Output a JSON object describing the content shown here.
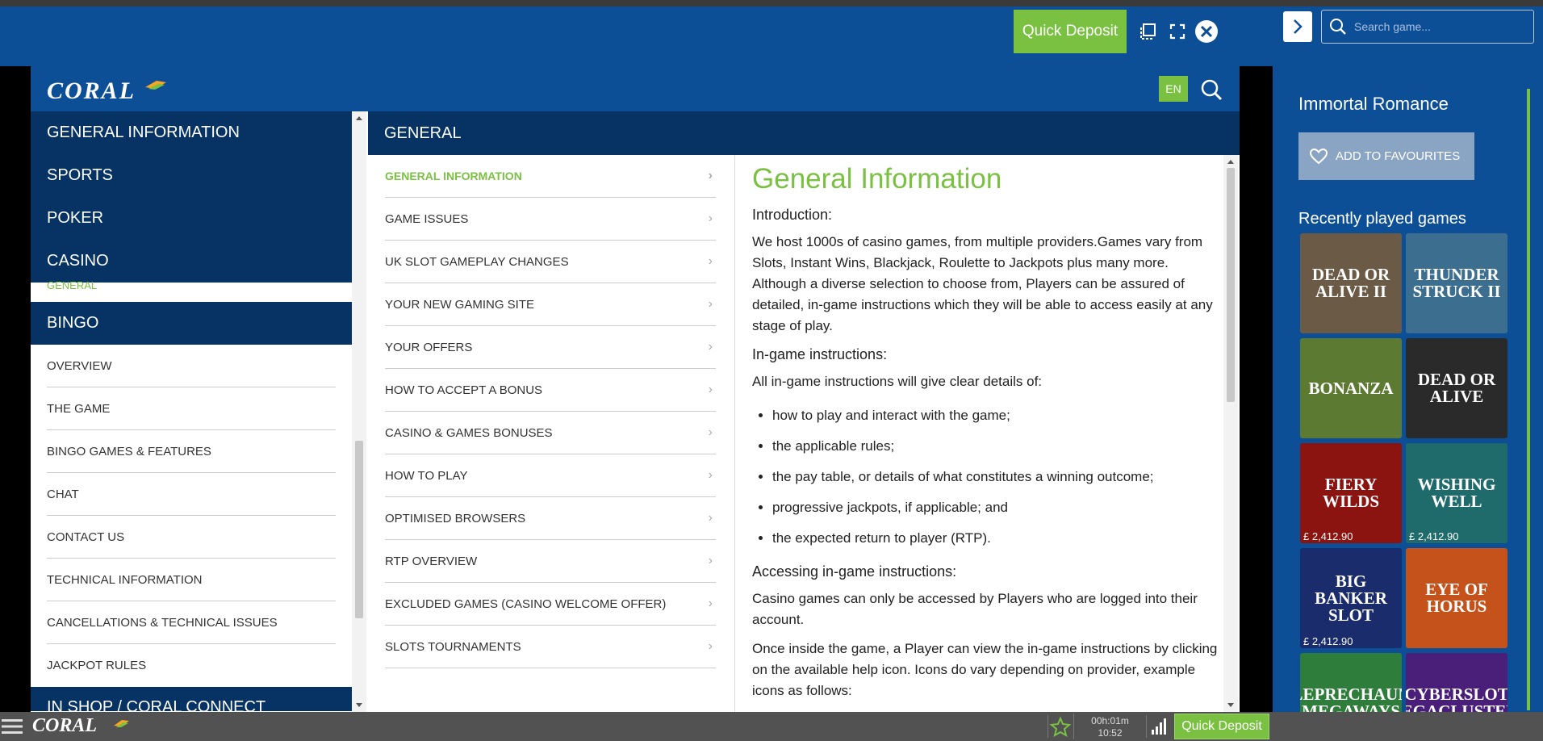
{
  "top_bar": {
    "quick_deposit": "Quick Deposit",
    "search_placeholder": "Search game..."
  },
  "help": {
    "logo": "CORAL",
    "lang": "EN",
    "section_title": "GENERAL",
    "left_nav": {
      "categories_top": [
        "GENERAL INFORMATION",
        "SPORTS",
        "POKER",
        "CASINO"
      ],
      "casino_active_sub": "GENERAL",
      "bingo": "BINGO",
      "bingo_items": [
        "OVERVIEW",
        "THE GAME",
        "BINGO GAMES & FEATURES",
        "CHAT",
        "CONTACT US",
        "TECHNICAL INFORMATION",
        "CANCELLATIONS & TECHNICAL ISSUES",
        "JACKPOT RULES"
      ],
      "next_category": "IN SHOP / CORAL CONNECT"
    },
    "mid_list": [
      "GENERAL INFORMATION",
      "GAME ISSUES",
      "UK SLOT GAMEPLAY CHANGES",
      "YOUR NEW GAMING SITE",
      "YOUR OFFERS",
      "HOW TO ACCEPT A BONUS",
      "CASINO & GAMES BONUSES",
      "HOW TO PLAY",
      "OPTIMISED BROWSERS",
      "RTP OVERVIEW",
      "EXCLUDED GAMES (CASINO WELCOME OFFER)",
      "SLOTS TOURNAMENTS"
    ],
    "content": {
      "title": "General Information",
      "intro_heading": "Introduction:",
      "intro_text": "We host 1000s of casino games, from multiple providers.Games vary from Slots, Instant Wins, Blackjack, Roulette to Jackpots plus many more. Although a diverse selection to choose from, Players can be assured of detailed, in-game instructions which they will be able to access easily at any stage of play.",
      "ingame_heading": "In-game instructions:",
      "ingame_text": "All in-game instructions will give clear details of:",
      "bullets": [
        "how to play and interact with the game;",
        "the applicable rules;",
        "the pay table, or details of what constitutes a winning outcome;",
        "progressive jackpots, if applicable; and",
        "the expected return to player (RTP)."
      ],
      "access_heading": "Accessing in-game instructions:",
      "access_text": "Casino games can only be accessed by Players who are logged into their account.",
      "once_text": "Once inside the game, a Player can view the in-game instructions by clicking on the available help icon.  Icons do vary depending on provider, example icons as follows:"
    }
  },
  "right_panel": {
    "game_title": "Immortal Romance",
    "add_fav": "ADD TO FAVOURITES",
    "recent_title": "Recently played games",
    "games": [
      {
        "name": "DEAD OR ALIVE II",
        "jackpot": "",
        "bg": "#6b5a45"
      },
      {
        "name": "THUNDER STRUCK II",
        "jackpot": "",
        "bg": "#3c6f8f"
      },
      {
        "name": "BONANZA",
        "jackpot": "",
        "bg": "#5d7a33"
      },
      {
        "name": "DEAD OR ALIVE",
        "jackpot": "",
        "bg": "#2a2a2a"
      },
      {
        "name": "FIERY WILDS",
        "jackpot": "£ 2,412.90",
        "bg": "#8b1410"
      },
      {
        "name": "WISHING WELL",
        "jackpot": "£ 2,412.90",
        "bg": "#1f6a6a"
      },
      {
        "name": "BIG BANKER SLOT",
        "jackpot": "£ 2,412.90",
        "bg": "#1a2c6b"
      },
      {
        "name": "EYE OF HORUS",
        "jackpot": "",
        "bg": "#c4521a"
      },
      {
        "name": "LEPRECHAUN MEGAWAYS",
        "jackpot": "",
        "bg": "#2f7d3a"
      },
      {
        "name": "CYBERSLOT MEGACLUSTERS",
        "jackpot": "",
        "bg": "#4a1f7a"
      }
    ]
  },
  "bottom_bar": {
    "logo": "CORAL",
    "session_time": "00h:01m",
    "clock": "10:52",
    "quick_deposit": "Quick Deposit"
  },
  "colors": {
    "brand_blue": "#0d4f97",
    "navy": "#063363",
    "accent_green": "#7ac142"
  }
}
